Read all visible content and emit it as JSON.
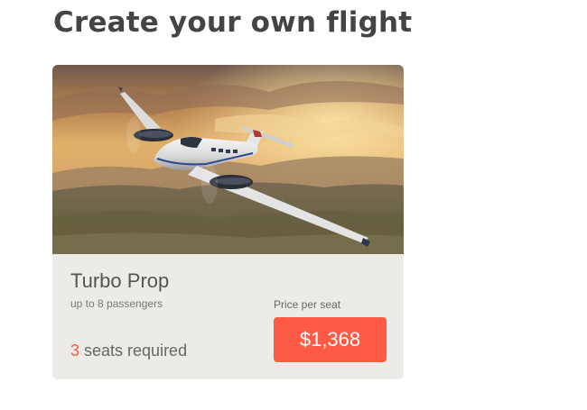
{
  "page": {
    "title": "Create your own flight"
  },
  "card": {
    "image_subject": "Turboprop aircraft in flight over hills at sunset",
    "aircraft_name": "Turbo Prop",
    "capacity": "up to 8 passengers",
    "seats_required_count": "3",
    "seats_required_label": " seats required",
    "price_label": "Price per seat",
    "price_value": "$1,368"
  },
  "colors": {
    "accent": "#ff5a45",
    "card_background": "#ecebe7",
    "title_text": "#444444"
  }
}
